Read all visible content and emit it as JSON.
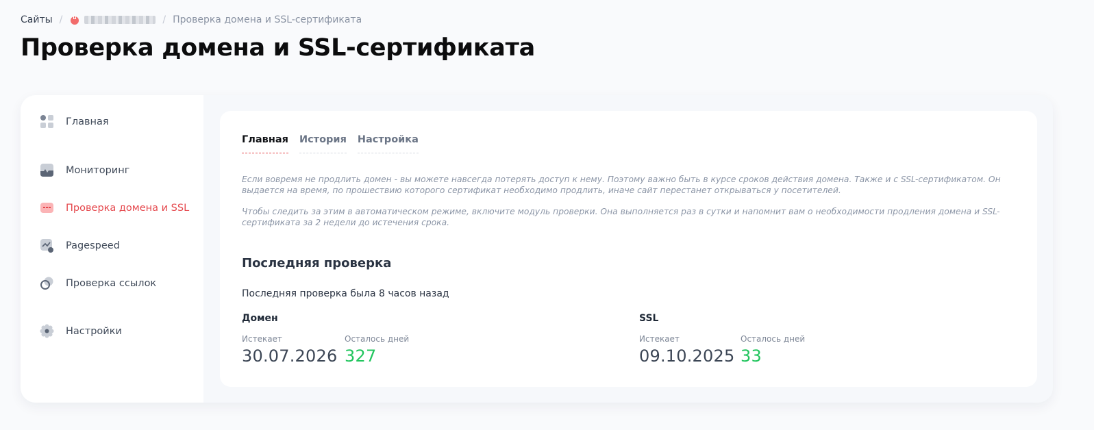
{
  "breadcrumb": {
    "sites": "Сайты",
    "separator": "/",
    "current": "Проверка домена и SSL-сертификата"
  },
  "page_title": "Проверка домена и SSL-сертификата",
  "sidebar": {
    "items": [
      {
        "label": "Главная",
        "icon": "grid-icon",
        "active": false
      },
      {
        "label": "Мониторинг",
        "icon": "monitor-icon",
        "active": false
      },
      {
        "label": "Проверка домена и SSL",
        "icon": "ssl-card-icon",
        "active": true
      },
      {
        "label": "Pagespeed",
        "icon": "speed-chart-icon",
        "active": false
      },
      {
        "label": "Проверка ссылок",
        "icon": "link-icon",
        "active": false
      },
      {
        "label": "Настройки",
        "icon": "gear-icon",
        "active": false
      }
    ]
  },
  "tabs": [
    {
      "label": "Главная",
      "active": true
    },
    {
      "label": "История",
      "active": false
    },
    {
      "label": "Настройка",
      "active": false
    }
  ],
  "info": {
    "p1": "Если вовремя не продлить домен - вы можете навсегда потерять доступ к нему. Поэтому важно быть в курсе сроков действия домена. Также и с SSL-сертификатом. Он выдается на время, по прошествию которого сертификат необходимо продлить, иначе сайт перестанет открываться у посетителей.",
    "p2": "Чтобы следить за этим в автоматическом режиме, включите модуль проверки. Она выполняется раз в сутки и напомнит вам о необходимости продления домена и SSL-сертификата за 2 недели до истечения срока."
  },
  "last_check": {
    "title": "Последняя проверка",
    "text": "Последняя проверка была 8 часов назад"
  },
  "domain": {
    "title": "Домен",
    "expires_label": "Истекает",
    "expires_value": "30.07.2026",
    "days_label": "Осталось дней",
    "days_value": "327"
  },
  "ssl": {
    "title": "SSL",
    "expires_label": "Истекает",
    "expires_value": "09.10.2025",
    "days_label": "Осталось дней",
    "days_value": "33"
  },
  "colors": {
    "accent": "#e5484d",
    "ok": "#22c55e",
    "background": "#f9fafc"
  }
}
